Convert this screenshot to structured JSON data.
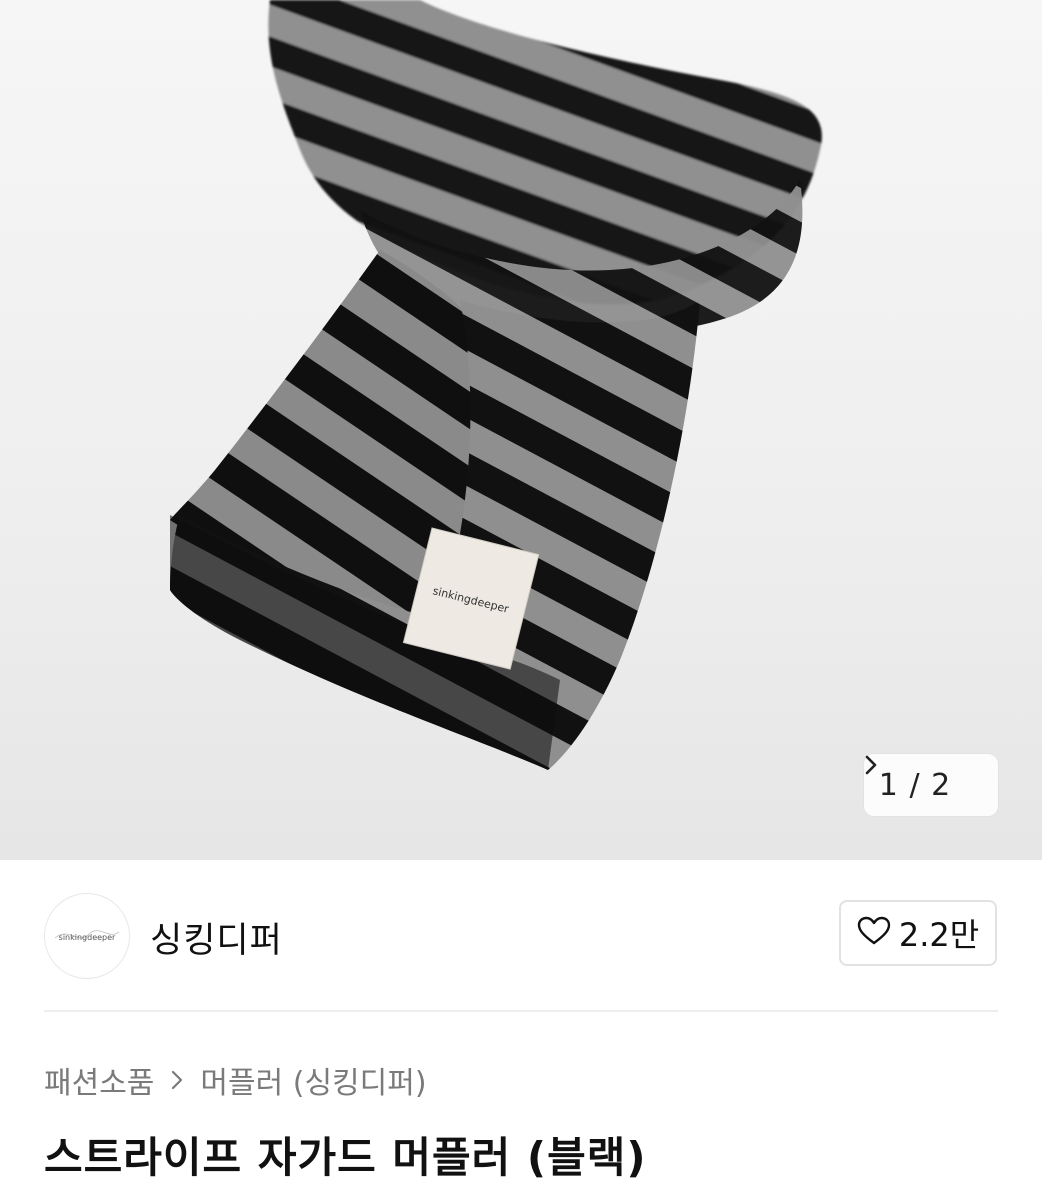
{
  "gallery": {
    "current_page": "1",
    "total_pages": "2",
    "separator": "/",
    "label_text": "scarf product photo",
    "tag_text": "sinkingdeeper"
  },
  "seller": {
    "name": "싱킹디퍼",
    "avatar_text": "sinkingdeeper",
    "like_count": "2.2만"
  },
  "breadcrumb": {
    "category": "패션소품",
    "subcategory": "머플러 (싱킹디퍼)"
  },
  "product": {
    "title": "스트라이프 자가드 머플러 (블랙)"
  },
  "colors": {
    "stripe_dark": "#111111",
    "stripe_light": "#8f8f8f",
    "background": "#efefef"
  }
}
